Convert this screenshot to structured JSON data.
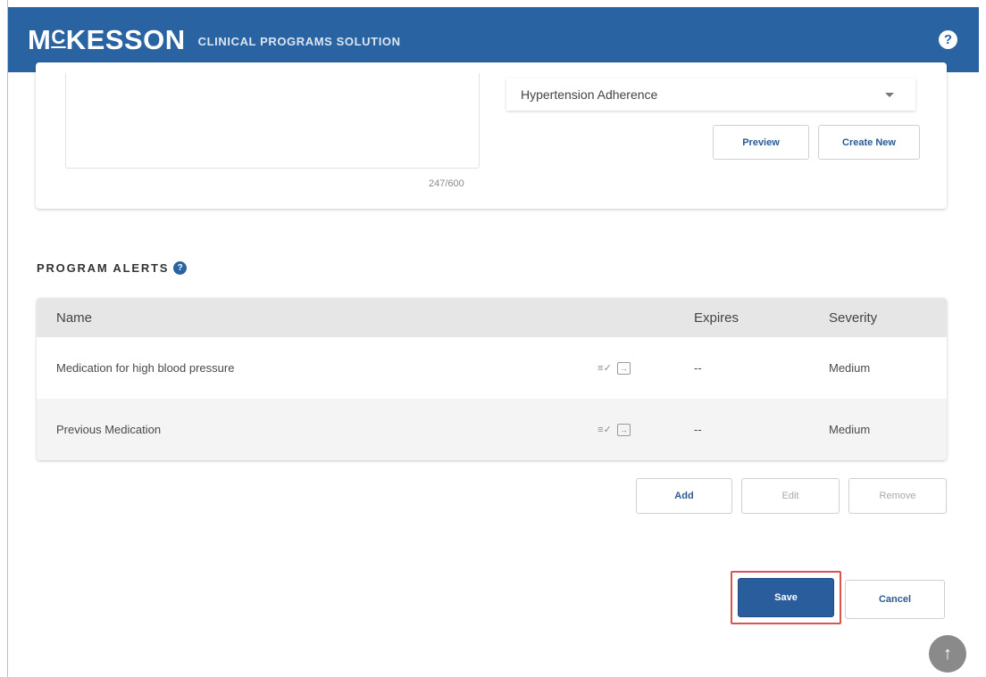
{
  "header": {
    "brand_prefix": "M",
    "brand_small": "C",
    "brand_rest": "KESSON",
    "product": "CLINICAL PROGRAMS SOLUTION",
    "help_glyph": "?",
    "bg_color": "#2a63a1"
  },
  "content_card": {
    "char_count": "247/600",
    "dropdown_value": "Hypertension Adherence",
    "preview_label": "Preview",
    "create_new_label": "Create New"
  },
  "alerts": {
    "title": "PROGRAM ALERTS",
    "help_glyph": "?",
    "columns": {
      "name": "Name",
      "expires": "Expires",
      "severity": "Severity"
    },
    "rows": [
      {
        "name": "Medication for high blood pressure",
        "expires": "--",
        "severity": "Medium"
      },
      {
        "name": "Previous Medication",
        "expires": "--",
        "severity": "Medium"
      }
    ],
    "add_label": "Add",
    "edit_label": "Edit",
    "remove_label": "Remove"
  },
  "footer": {
    "save_label": "Save",
    "cancel_label": "Cancel",
    "scroll_top_glyph": "↑"
  }
}
